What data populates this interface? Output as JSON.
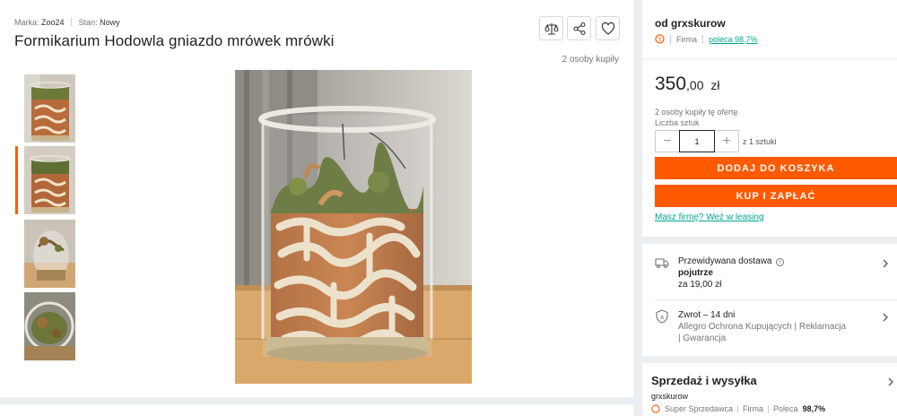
{
  "product": {
    "brand_label": "Marka:",
    "brand_value": "Zoo24",
    "condition_label": "Stan:",
    "condition_value": "Nowy",
    "title": "Formikarium Hodowla gniazdo mrówek mrówki",
    "bought_count": "2 osoby kupiły"
  },
  "actions": {
    "icons": [
      "compare-icon",
      "share-icon",
      "heart-icon"
    ]
  },
  "seller": {
    "name": "od grxskurow",
    "type": "Firma",
    "recommend": "poleca 98,7%"
  },
  "pricing": {
    "price_int": "350",
    "price_dec": ",00",
    "currency": "zł",
    "bought_offer": "2 osoby kupiły tę ofertę",
    "qty_label": "Liczba sztuk",
    "qty_value": "1",
    "qty_of": "z 1 sztuki",
    "add_to_cart": "DODAJ DO KOSZYKA",
    "buy_now": "KUP I ZAPŁAĆ",
    "leasing_link": "Masz firmę? Weź w leasing"
  },
  "delivery": {
    "label": "Przewidywana dostawa",
    "when": "pojutrze",
    "cost": "za 19,00 zł",
    "return_title": "Zwrot – 14 dni",
    "return_line1": "Allegro Ochrona Kupujących | Reklamacja",
    "return_line2": "| Gwarancja"
  },
  "sales": {
    "title": "Sprzedaż i wysyłka",
    "seller": "grxskurow",
    "super": "Super Sprzedawca",
    "type": "Firma",
    "recommend_label": "Poleca",
    "recommend_value": "98,7%"
  },
  "colors": {
    "accent": "#ff5a00",
    "link": "#00a790",
    "background": "#eceff1"
  }
}
